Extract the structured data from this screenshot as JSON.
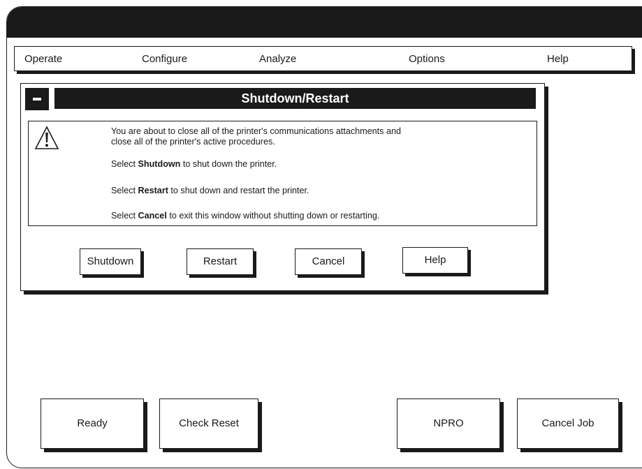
{
  "menu": {
    "operate": "Operate",
    "configure": "Configure",
    "analyze": "Analyze",
    "options": "Options",
    "help": "Help"
  },
  "dialog": {
    "title": "Shutdown/Restart",
    "icon": "warning-icon",
    "message_line1": "You are about to close all of the printer's communications attachments and",
    "message_line2": "close all of the printer's active procedures.",
    "select_word": "Select",
    "shutdown_word": "Shutdown",
    "shutdown_rest": "to shut down the printer.",
    "restart_word": "Restart",
    "restart_rest": "to shut down and restart the printer.",
    "cancel_word": "Cancel",
    "cancel_rest": "to exit this window without shutting down or restarting.",
    "buttons": {
      "shutdown": "Shutdown",
      "restart": "Restart",
      "cancel": "Cancel",
      "help": "Help"
    }
  },
  "bottom_buttons": {
    "ready": "Ready",
    "check_reset": "Check Reset",
    "npro": "NPRO",
    "cancel_job": "Cancel Job"
  }
}
